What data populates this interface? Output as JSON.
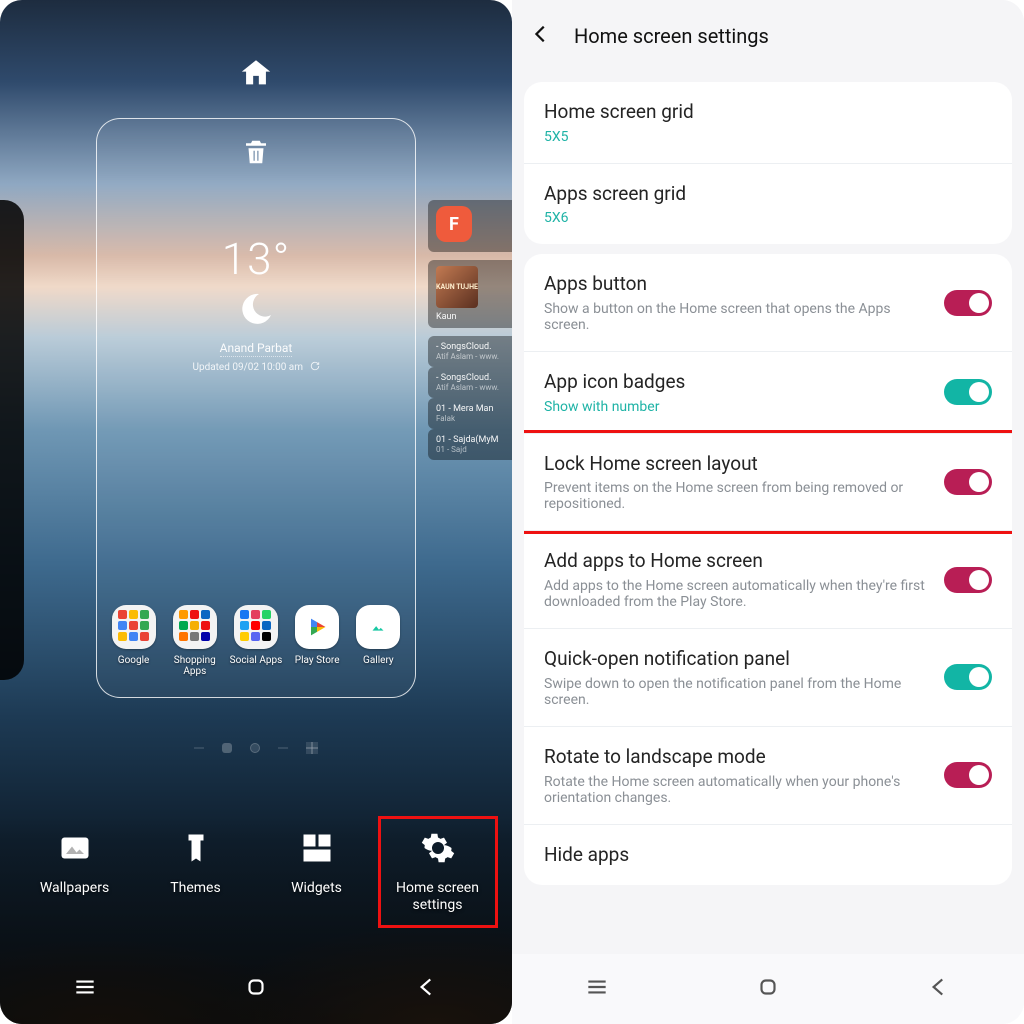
{
  "left": {
    "weather": {
      "temp": "13°",
      "location": "Anand Parbat",
      "updated": "Updated 09/02 10:00 am"
    },
    "apps": [
      {
        "label": "Google",
        "kind": "folder",
        "colors": [
          "#ea4335",
          "#fbbc05",
          "#34a853",
          "#4285f4",
          "#ea4335",
          "#34a853",
          "#fbbc05",
          "#4285f4",
          "#ea4335"
        ]
      },
      {
        "label": "Shopping Apps",
        "kind": "folder",
        "colors": [
          "#ff9900",
          "#e11",
          "#0a66c2",
          "#00a850",
          "#f5af02",
          "#e11",
          "#ff7400",
          "#777",
          "#00a"
        ]
      },
      {
        "label": "Social Apps",
        "kind": "folder",
        "colors": [
          "#1877f2",
          "#e4405f",
          "#25d366",
          "#1da1f2",
          "#ff0000",
          "#0a66c2",
          "#ffcc00",
          "#5865f2",
          "#000"
        ]
      },
      {
        "label": "Play Store",
        "kind": "play"
      },
      {
        "label": "Gallery",
        "kind": "gallery"
      }
    ],
    "peek": {
      "flip_letter": "F",
      "media": {
        "title": "Kaun",
        "thumb_text": "KAUN TUJHE"
      },
      "tracks": [
        {
          "t1": "- SongsCloud.",
          "t2": "Atif Aslam - www."
        },
        {
          "t1": "- SongsCloud.",
          "t2": "Atif Aslam - www."
        },
        {
          "t1": "01 - Mera Man",
          "t2": "Falak"
        },
        {
          "t1": "01 - Sajda(MyM",
          "t2": "01 - Sajd"
        }
      ]
    },
    "bottom_actions": [
      {
        "label": "Wallpapers"
      },
      {
        "label": "Themes"
      },
      {
        "label": "Widgets"
      },
      {
        "label": "Home screen settings"
      }
    ]
  },
  "right": {
    "title": "Home screen settings",
    "groups": [
      {
        "rows": [
          {
            "title": "Home screen grid",
            "sub": "5X5",
            "sub_style": "teal"
          },
          {
            "title": "Apps screen grid",
            "sub": "5X6",
            "sub_style": "teal"
          }
        ]
      },
      {
        "rows": [
          {
            "title": "Apps button",
            "sub": "Show a button on the Home screen that opens the Apps screen.",
            "sub_style": "grey",
            "toggle": "on-pink"
          },
          {
            "title": "App icon badges",
            "sub": "Show with number",
            "sub_style": "teal",
            "toggle": "on-teal"
          },
          {
            "title": "Lock Home screen layout",
            "sub": "Prevent items on the Home screen from being removed or repositioned.",
            "sub_style": "grey",
            "toggle": "on-pink",
            "highlight": true
          },
          {
            "title": "Add apps to Home screen",
            "sub": "Add apps to the Home screen automatically when they're first downloaded from the Play Store.",
            "sub_style": "grey",
            "toggle": "on-pink"
          },
          {
            "title": "Quick-open notification panel",
            "sub": "Swipe down to open the notification panel from the Home screen.",
            "sub_style": "grey",
            "toggle": "on-teal"
          },
          {
            "title": "Rotate to landscape mode",
            "sub": "Rotate the Home screen automatically when your phone's orientation changes.",
            "sub_style": "grey",
            "toggle": "on-pink"
          },
          {
            "title": "Hide apps"
          }
        ]
      }
    ]
  }
}
